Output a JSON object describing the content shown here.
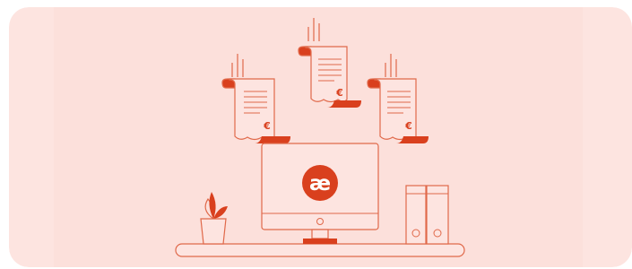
{
  "theme": {
    "background_color": "#fde4e0",
    "panel_color": "#fce0db",
    "line_color": "#e0694a",
    "accent_color": "#d9401e",
    "paper_color": "#fde4e0",
    "logo_text_color": "#ffffff"
  },
  "logo": {
    "text": "æ",
    "icon": "ae-logo-icon"
  },
  "receipts": [
    {
      "currency_symbol": "€",
      "icon": "receipt-icon"
    },
    {
      "currency_symbol": "€",
      "icon": "receipt-icon"
    },
    {
      "currency_symbol": "€",
      "icon": "receipt-icon"
    }
  ],
  "objects": {
    "monitor": "monitor-icon",
    "plant": "plant-icon",
    "binders": "binders-icon",
    "desk": "desk-icon"
  }
}
